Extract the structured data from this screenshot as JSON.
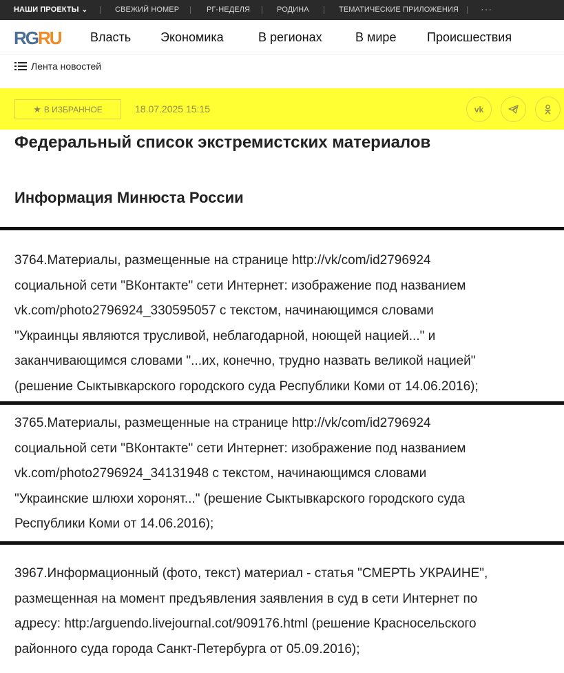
{
  "topbar": {
    "projects_label": "НАШИ ПРОЕКТЫ",
    "items": [
      "СВЕЖИЙ НОМЕР",
      "РГ-НЕДЕЛЯ",
      "РОДИНА",
      "ТЕМАТИЧЕСКИЕ ПРИЛОЖЕНИЯ"
    ],
    "more": "···"
  },
  "logo": {
    "part1": "RG",
    "part2": "RU"
  },
  "nav": [
    "Власть",
    "Экономика",
    "В регионах",
    "В мире",
    "Происшествия"
  ],
  "feed_label": "Лента новостей",
  "actions": {
    "favorite_label": "В ИЗБРАННОЕ",
    "datetime": "18.07.2025 15:15",
    "share_icons": [
      "vk-icon",
      "telegram-icon",
      "odnoklassniki-icon"
    ]
  },
  "article": {
    "title": "Федеральный список экстремистских материалов",
    "subtitle": "Информация Минюста России",
    "paragraphs": [
      "3764.Материалы, размещенные на странице http://vk/com/id2796924\nсоциальной сети \"ВКонтакте\" сети Интернет: изображение под названием\nvk.com/photo2796924_330595057 с текстом, начинающимся словами\n\"Украинцы являются трусливой, неблагодарной, ноющей нацией...\" и\nзаканчивающимся словами \"...их, конечно, трудно назвать великой нацией\"\n(решение Сыктывкарского городского суда Республики Коми от 14.06.2016);",
      "3765.Материалы, размещенные на странице http://vk/com/id2796924\nсоциальной сети \"ВКонтакте\" сети Интернет: изображение под названием\nvk.com/photo2796924_34131948 с текстом, начинающимся словами\n\"Украинские шлюхи хоронят...\" (решение Сыктывкарского городского суда\nРеспублики Коми от 14.06.2016);",
      "3967.Информационный (фото, текст) материал - статья \"СМЕРТЬ УКРАИНЕ\",\nразмещенная на момент предъявления заявления в суд в сети Интернет по\nадресу: http:/arguendo.livejournal.cot/909176.html (решение Красносельского\nрайонного суда города Санкт-Петербурга от 05.09.2016);"
    ]
  },
  "colors": {
    "highlight": "#ffff33",
    "topbar_bg": "#2a2a2a",
    "logo_rg": "#4a6f93",
    "logo_ru": "#f08a24"
  }
}
